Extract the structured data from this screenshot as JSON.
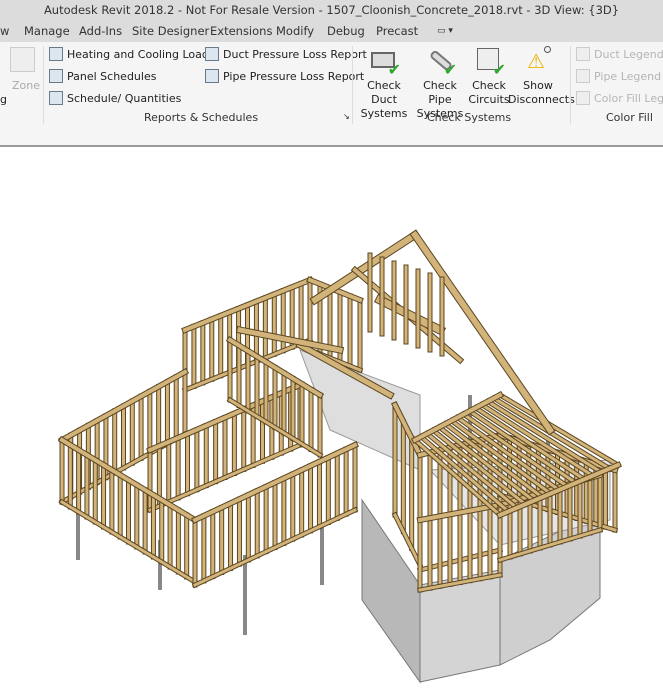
{
  "window": {
    "title": "Autodesk Revit 2018.2 - Not For Resale Version -     1507_Cloonish_Concrete_2018.rvt - 3D View: {3D}"
  },
  "tabs": [
    "w",
    "Manage",
    "Add-Ins",
    "Site Designer",
    "Extensions",
    "Modify",
    "Debug",
    "Precast"
  ],
  "ribbon": {
    "partial_left": {
      "zone_label": "Zone",
      "cut_label": "g"
    },
    "reports": {
      "items": [
        "Heating and  Cooling Loads",
        "Panel  Schedules",
        "Schedule/  Quantities",
        "Duct Pressure  Loss Report",
        "Pipe Pressure  Loss Report"
      ],
      "label": "Reports & Schedules",
      "launcher": "↘"
    },
    "check_systems": {
      "buttons": [
        {
          "line1": "Check Duct",
          "line2": "Systems",
          "icon": "duct-check-icon"
        },
        {
          "line1": "Check Pipe",
          "line2": "Systems",
          "icon": "pipe-check-icon"
        },
        {
          "line1": "Check",
          "line2": "Circuits",
          "icon": "circuit-check-icon"
        },
        {
          "line1": "Show",
          "line2": "Disconnects",
          "icon": "warning-disconnect-icon"
        }
      ],
      "label": "Check Systems"
    },
    "color_fill": {
      "items": [
        "Duct  Legend",
        "Pipe  Legend",
        "Color Fill  Legend"
      ],
      "label": "Color Fill"
    }
  },
  "colors": {
    "timber": "#d2b47a",
    "timber_edge": "#5a4520",
    "concrete": "#c8c8c8",
    "ribbon_bg": "#f5f5f5",
    "check_green": "#2ea82e"
  }
}
